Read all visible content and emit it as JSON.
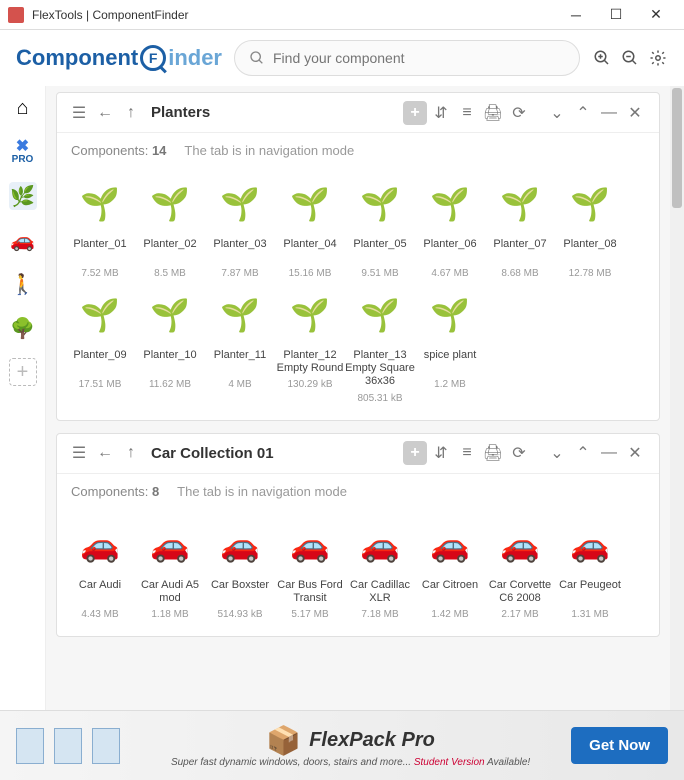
{
  "window": {
    "title": "FlexTools | ComponentFinder"
  },
  "brand": {
    "part1": "Component",
    "part2": "inder",
    "icon_letter": "F"
  },
  "search": {
    "placeholder": "Find your component"
  },
  "sidebar": {
    "pro_label": "PRO"
  },
  "panels": [
    {
      "title": "Planters",
      "meta_label": "Components:",
      "count": "14",
      "mode": "The tab is in navigation mode",
      "items": [
        {
          "name": "Planter_01",
          "size": "7.52 MB",
          "cls": "plant"
        },
        {
          "name": "Planter_02",
          "size": "8.5 MB",
          "cls": "plant"
        },
        {
          "name": "Planter_03",
          "size": "7.87 MB",
          "cls": "plant"
        },
        {
          "name": "Planter_04",
          "size": "15.16 MB",
          "cls": "plant"
        },
        {
          "name": "Planter_05",
          "size": "9.51 MB",
          "cls": "plant"
        },
        {
          "name": "Planter_06",
          "size": "4.67 MB",
          "cls": "plant"
        },
        {
          "name": "Planter_07",
          "size": "8.68 MB",
          "cls": "plant"
        },
        {
          "name": "Planter_08",
          "size": "12.78 MB",
          "cls": "plant"
        },
        {
          "name": "Planter_09",
          "size": "17.51 MB",
          "cls": "plant"
        },
        {
          "name": "Planter_10",
          "size": "11.62 MB",
          "cls": "plant"
        },
        {
          "name": "Planter_11",
          "size": "4 MB",
          "cls": "plant"
        },
        {
          "name": "Planter_12 Empty Round",
          "size": "130.29 kB",
          "cls": "plant"
        },
        {
          "name": "Planter_13 Empty Square 36x36",
          "size": "805.31 kB",
          "cls": "plant"
        },
        {
          "name": "spice plant",
          "size": "1.2 MB",
          "cls": "plant"
        }
      ]
    },
    {
      "title": "Car Collection 01",
      "meta_label": "Components:",
      "count": "8",
      "mode": "The tab is in navigation mode",
      "items": [
        {
          "name": "Car Audi",
          "size": "4.43 MB",
          "cls": "car-y"
        },
        {
          "name": "Car Audi A5 mod",
          "size": "1.18 MB",
          "cls": "car-s"
        },
        {
          "name": "Car Boxster",
          "size": "514.93 kB",
          "cls": "car-y"
        },
        {
          "name": "Car Bus Ford Transit",
          "size": "5.17 MB",
          "cls": "car-s"
        },
        {
          "name": "Car Cadillac XLR",
          "size": "7.18 MB",
          "cls": "car-s"
        },
        {
          "name": "Car Citroen",
          "size": "1.42 MB",
          "cls": "car-b"
        },
        {
          "name": "Car Corvette C6 2008",
          "size": "2.17 MB",
          "cls": "car-r"
        },
        {
          "name": "Car Peugeot",
          "size": "1.31 MB",
          "cls": "car-y"
        }
      ]
    }
  ],
  "footer": {
    "brand": "FlexPack Pro",
    "sub": "Super fast dynamic windows, doors, stairs and more...",
    "student": "Student Version",
    "available": " Available!",
    "button": "Get Now"
  }
}
